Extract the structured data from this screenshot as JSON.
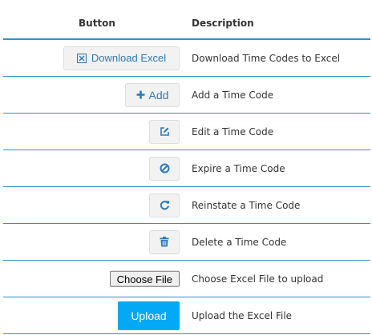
{
  "header": {
    "button_col": "Button",
    "description_col": "Description"
  },
  "rows": [
    {
      "button_label": "Download Excel",
      "icon": "excel-icon",
      "description": "Download Time Codes to Excel"
    },
    {
      "button_label": "Add",
      "icon": "plus-icon",
      "description": "Add a Time Code"
    },
    {
      "button_label": "",
      "icon": "edit-icon",
      "description": "Edit a Time Code"
    },
    {
      "button_label": "",
      "icon": "ban-icon",
      "description": "Expire a Time Code"
    },
    {
      "button_label": "",
      "icon": "refresh-icon",
      "description": "Reinstate a Time Code"
    },
    {
      "button_label": "",
      "icon": "trash-icon",
      "description": "Delete a Time Code"
    },
    {
      "button_label": "Choose File",
      "icon": "",
      "description": "Choose Excel File to upload"
    },
    {
      "button_label": "Upload",
      "icon": "",
      "description": "Upload the Excel File"
    }
  ],
  "colors": {
    "accent": "#2a93cf",
    "button_text": "#2e7ab8",
    "upload_bg": "#03a9f4"
  }
}
